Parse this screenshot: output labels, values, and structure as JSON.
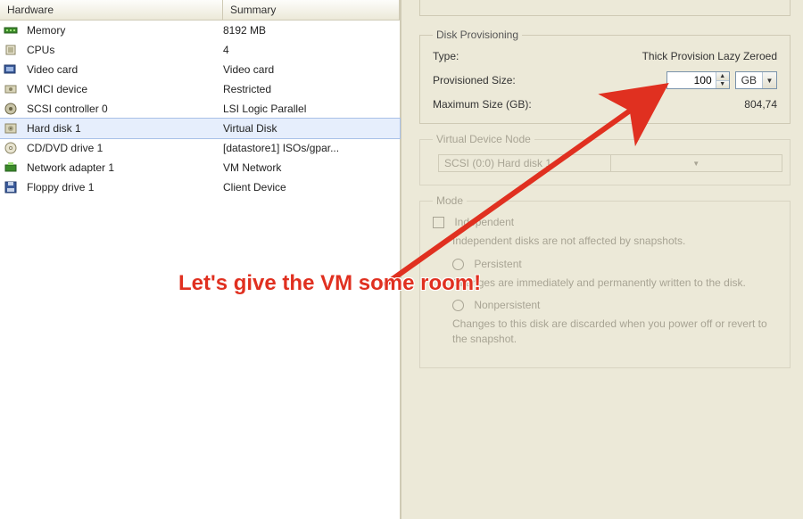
{
  "hardware_table": {
    "columns": {
      "hardware": "Hardware",
      "summary": "Summary"
    },
    "rows": [
      {
        "icon": "memory-icon",
        "name": "Memory",
        "summary": "8192 MB",
        "selected": false
      },
      {
        "icon": "cpu-icon",
        "name": "CPUs",
        "summary": "4",
        "selected": false
      },
      {
        "icon": "video-icon",
        "name": "Video card",
        "summary": "Video card",
        "selected": false
      },
      {
        "icon": "vmci-icon",
        "name": "VMCI device",
        "summary": "Restricted",
        "selected": false
      },
      {
        "icon": "scsi-icon",
        "name": "SCSI controller 0",
        "summary": "LSI Logic Parallel",
        "selected": false
      },
      {
        "icon": "disk-icon",
        "name": "Hard disk 1",
        "summary": "Virtual Disk",
        "selected": true
      },
      {
        "icon": "cd-icon",
        "name": "CD/DVD drive 1",
        "summary": "[datastore1] ISOs/gpar...",
        "selected": false
      },
      {
        "icon": "nic-icon",
        "name": "Network adapter 1",
        "summary": "VM Network",
        "selected": false
      },
      {
        "icon": "floppy-icon",
        "name": "Floppy drive 1",
        "summary": "Client Device",
        "selected": false
      }
    ]
  },
  "disk_provisioning": {
    "legend": "Disk Provisioning",
    "type_label": "Type:",
    "type_value": "Thick Provision Lazy Zeroed",
    "size_label": "Provisioned Size:",
    "size_value": "100",
    "size_unit": "GB",
    "max_label": "Maximum Size (GB):",
    "max_value": "804,74"
  },
  "virtual_device_node": {
    "legend": "Virtual Device Node",
    "value": "SCSI (0:0) Hard disk 1"
  },
  "mode": {
    "legend": "Mode",
    "independent_label": "Independent",
    "independent_desc": "Independent disks are not affected by snapshots.",
    "persistent_label": "Persistent",
    "persistent_desc": "Changes are immediately and permanently written to the disk.",
    "nonpersistent_label": "Nonpersistent",
    "nonpersistent_desc": "Changes to this disk are discarded when you power off or revert to the snapshot."
  },
  "annotation": "Let's give the VM some room!"
}
